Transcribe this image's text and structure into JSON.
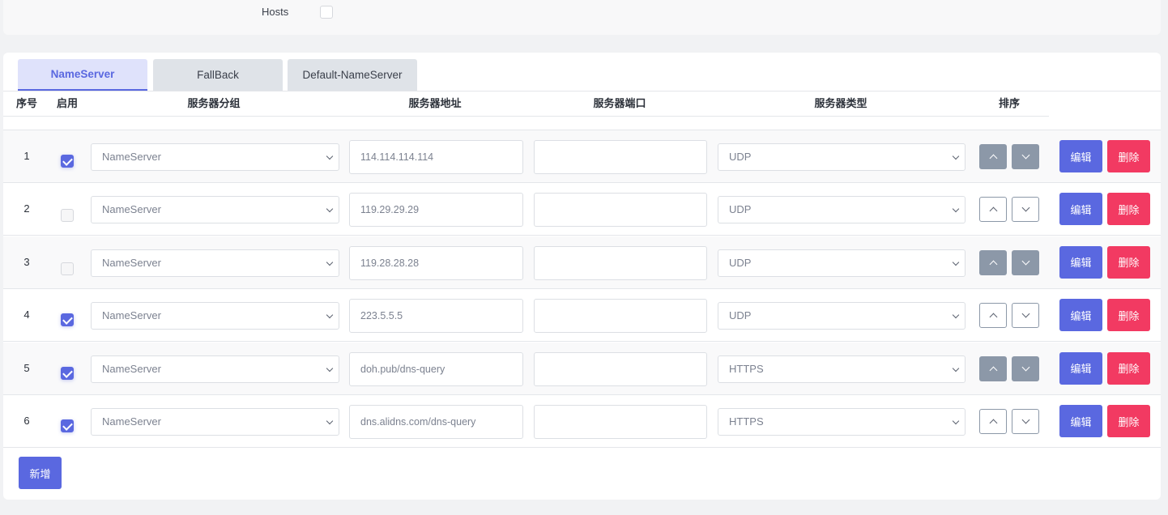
{
  "hosts": {
    "label": "Hosts"
  },
  "tabs": [
    {
      "label": "NameServer",
      "active": true
    },
    {
      "label": "FallBack",
      "active": false
    },
    {
      "label": "Default-NameServer",
      "active": false
    }
  ],
  "table": {
    "headers": {
      "index": "序号",
      "enabled": "启用",
      "group": "服务器分组",
      "address": "服务器地址",
      "port": "服务器端口",
      "type": "服务器类型",
      "sort": "排序"
    },
    "rows": [
      {
        "index": "1",
        "enabled": true,
        "group": "NameServer",
        "address": "114.114.114.114",
        "port": "",
        "type": "UDP",
        "sort_enabled": false,
        "edit": "编辑",
        "delete": "删除"
      },
      {
        "index": "2",
        "enabled": false,
        "group": "NameServer",
        "address": "119.29.29.29",
        "port": "",
        "type": "UDP",
        "sort_enabled": true,
        "edit": "编辑",
        "delete": "删除"
      },
      {
        "index": "3",
        "enabled": false,
        "group": "NameServer",
        "address": "119.28.28.28",
        "port": "",
        "type": "UDP",
        "sort_enabled": false,
        "edit": "编辑",
        "delete": "删除"
      },
      {
        "index": "4",
        "enabled": true,
        "group": "NameServer",
        "address": "223.5.5.5",
        "port": "",
        "type": "UDP",
        "sort_enabled": true,
        "edit": "编辑",
        "delete": "删除"
      },
      {
        "index": "5",
        "enabled": true,
        "group": "NameServer",
        "address": "doh.pub/dns-query",
        "port": "",
        "type": "HTTPS",
        "sort_enabled": false,
        "edit": "编辑",
        "delete": "删除"
      },
      {
        "index": "6",
        "enabled": true,
        "group": "NameServer",
        "address": "dns.alidns.com/dns-query",
        "port": "",
        "type": "HTTPS",
        "sort_enabled": true,
        "edit": "编辑",
        "delete": "删除"
      }
    ]
  },
  "add_button": "新增",
  "colors": {
    "primary": "#5a68e0",
    "danger": "#f23a62",
    "disabled": "#8c98a8"
  },
  "icons": {
    "select": "chevron-down-icon",
    "sort_up": "chevron-up-icon",
    "sort_down": "chevron-down-icon",
    "check": "check-icon"
  }
}
